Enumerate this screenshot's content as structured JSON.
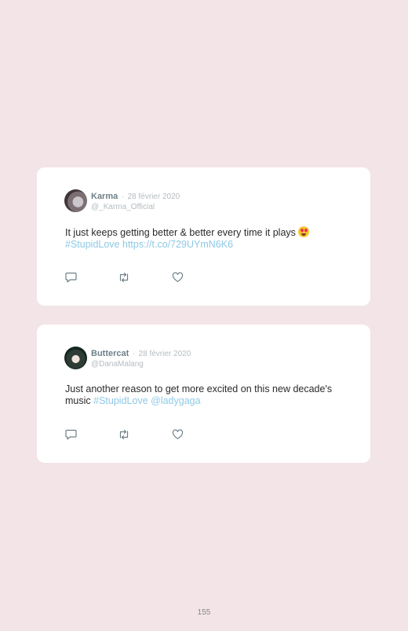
{
  "tweets": [
    {
      "name": "Karma",
      "separator": "·",
      "date": "28 février 2020",
      "handle": "@_Karma_Official",
      "text": "It just keeps getting better & better every time it plays",
      "emoji": "heart-eyes-emoji",
      "link_1": "#StupidLove",
      "link_2": "https://t.co/729UYmN6K6"
    },
    {
      "name": "Buttercat",
      "separator": "·",
      "date": "28 février 2020",
      "handle": "@DanaMalang",
      "text": "Just another reason to get more excited on this new decade's music",
      "link_1": "#StupidLove",
      "link_2": "@ladygaga"
    }
  ],
  "icons": [
    "reply-icon",
    "retweet-icon",
    "like-icon"
  ],
  "page_number": "155",
  "colors": {
    "background": "#f3e4e8",
    "card": "#ffffff",
    "name": "#6d8089",
    "muted": "#b4bcc1",
    "link": "#8ec9e6",
    "icon": "#6d8089"
  }
}
